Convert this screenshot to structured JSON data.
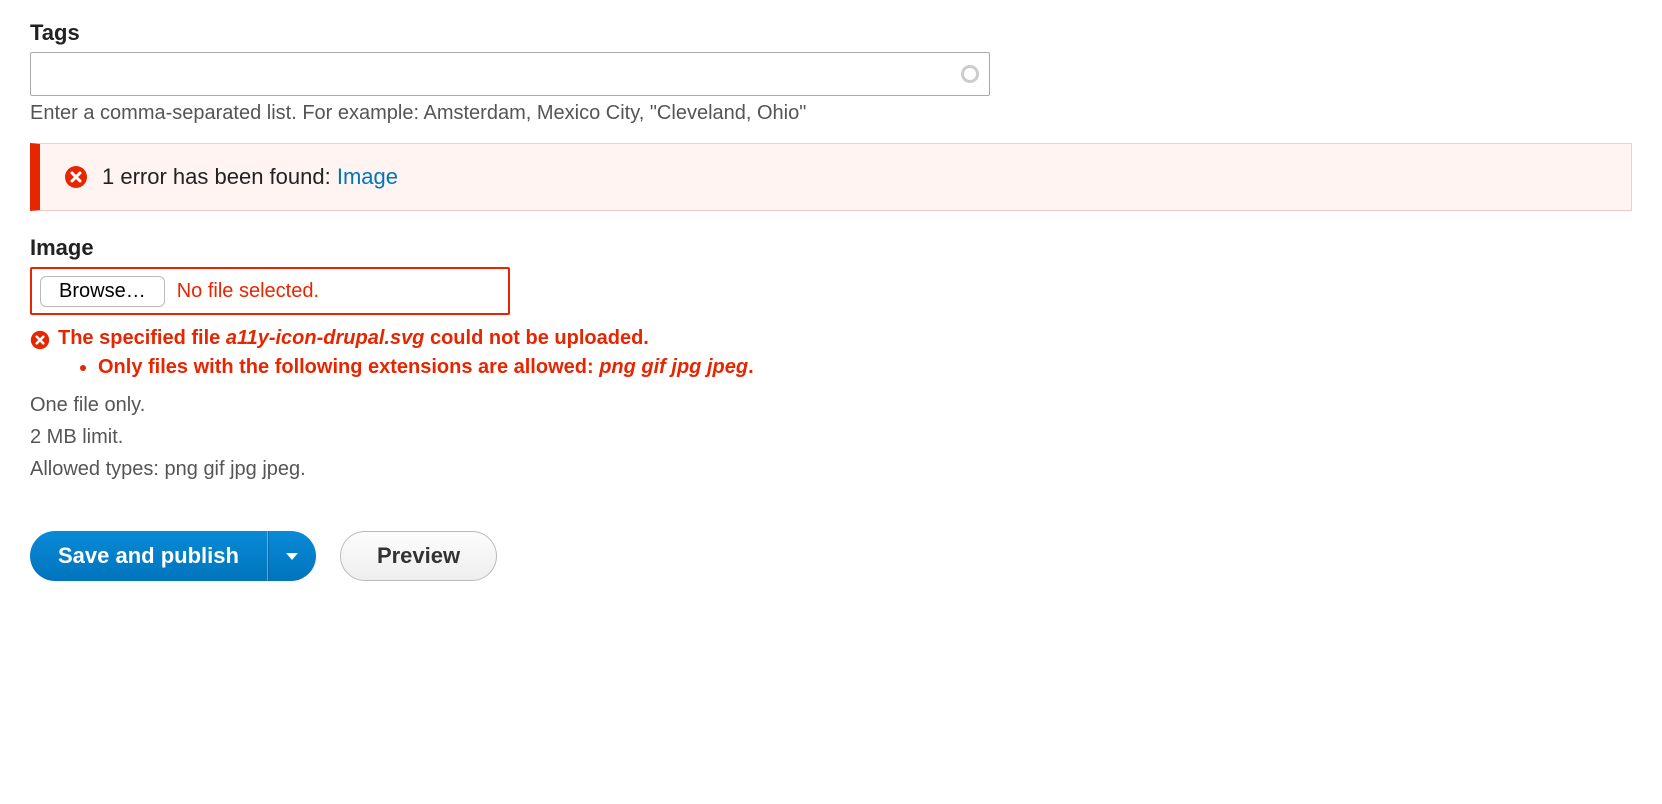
{
  "tags": {
    "label": "Tags",
    "help": "Enter a comma-separated list. For example: Amsterdam, Mexico City, \"Cleveland, Ohio\""
  },
  "alert": {
    "prefix": "1 error has been found: ",
    "link_text": "Image"
  },
  "image": {
    "label": "Image",
    "browse_label": "Browse…",
    "no_file_text": "No file selected.",
    "error_prefix": "The specified file ",
    "error_filename": "a11y-icon-drupal.svg",
    "error_suffix": " could not be uploaded.",
    "ext_error_prefix": "Only files with the following extensions are allowed: ",
    "ext_error_exts": "png gif jpg jpeg",
    "ext_error_suffix": ".",
    "desc_line1": "One file only.",
    "desc_line2": "2 MB limit.",
    "desc_line3": "Allowed types: png gif jpg jpeg."
  },
  "actions": {
    "save": "Save and publish",
    "preview": "Preview"
  }
}
